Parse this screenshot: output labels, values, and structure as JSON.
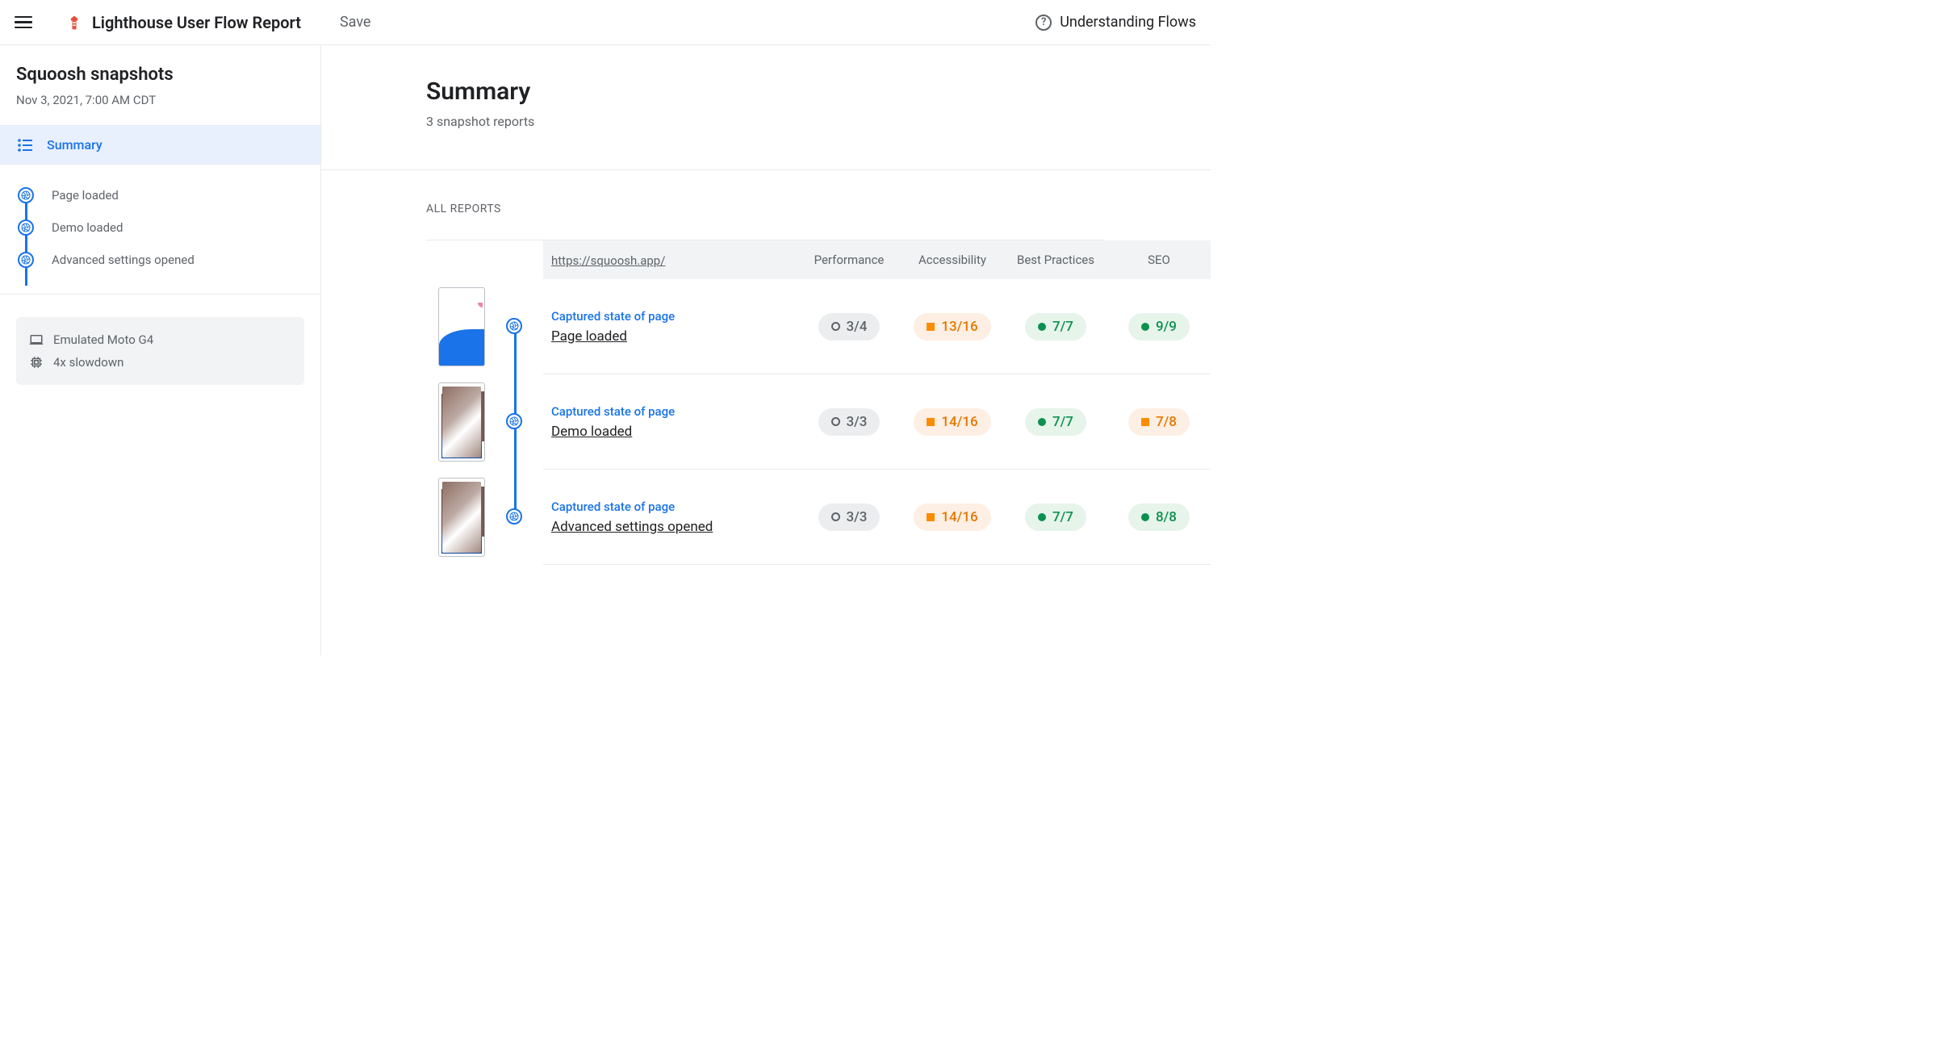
{
  "topbar": {
    "title": "Lighthouse User Flow Report",
    "save": "Save",
    "help": "Understanding Flows"
  },
  "sidebar": {
    "title": "Squoosh snapshots",
    "date": "Nov 3, 2021, 7:00 AM CDT",
    "summary_label": "Summary",
    "steps": [
      {
        "label": "Page loaded"
      },
      {
        "label": "Demo loaded"
      },
      {
        "label": "Advanced settings opened"
      }
    ],
    "meta": {
      "device": "Emulated Moto G4",
      "throttle": "4x slowdown"
    }
  },
  "main": {
    "title": "Summary",
    "subtitle": "3 snapshot reports",
    "all_reports": "ALL REPORTS",
    "url": "https://squoosh.app/",
    "columns": [
      "Performance",
      "Accessibility",
      "Best Practices",
      "SEO"
    ],
    "caption": "Captured state of page",
    "rows": [
      {
        "name": "Page loaded",
        "thumb": "wave",
        "scores": [
          {
            "value": "3/4",
            "status": "gray"
          },
          {
            "value": "13/16",
            "status": "orange"
          },
          {
            "value": "7/7",
            "status": "green"
          },
          {
            "value": "9/9",
            "status": "green"
          }
        ]
      },
      {
        "name": "Demo loaded",
        "thumb": "cat",
        "scores": [
          {
            "value": "3/3",
            "status": "gray"
          },
          {
            "value": "14/16",
            "status": "orange"
          },
          {
            "value": "7/7",
            "status": "green"
          },
          {
            "value": "7/8",
            "status": "orange"
          }
        ]
      },
      {
        "name": "Advanced settings opened",
        "thumb": "cat",
        "scores": [
          {
            "value": "3/3",
            "status": "gray"
          },
          {
            "value": "14/16",
            "status": "orange"
          },
          {
            "value": "7/7",
            "status": "green"
          },
          {
            "value": "8/8",
            "status": "green"
          }
        ]
      }
    ]
  }
}
